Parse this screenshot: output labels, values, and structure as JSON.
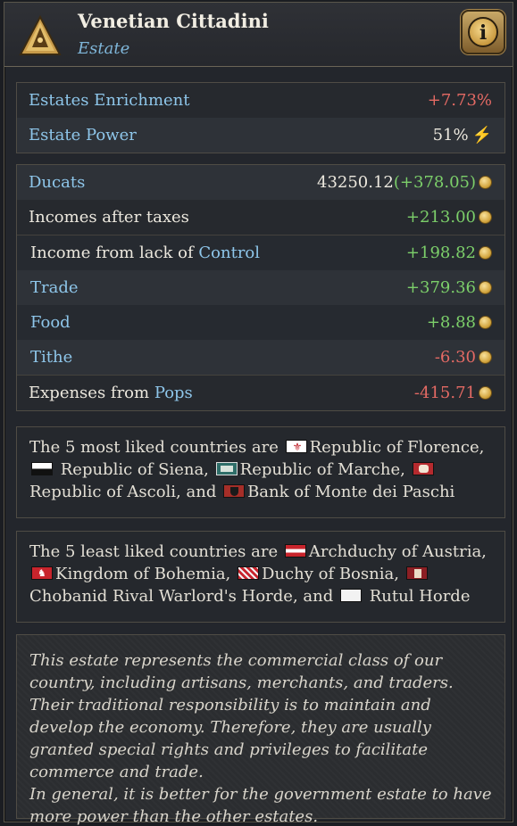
{
  "header": {
    "title": "Venetian Cittadini",
    "subtitle": "Estate",
    "info_glyph": "i"
  },
  "stats": {
    "enrichment_label": "Estates Enrichment",
    "enrichment_value": "+7.73%",
    "power_label": "Estate Power",
    "power_value": "51%"
  },
  "finance": {
    "ducats_label": "Ducats",
    "ducats_value": "43250.12",
    "ducats_change": "(+378.05)",
    "incomes_label": "Incomes after taxes",
    "incomes_value": "+213.00",
    "control_label_prefix": "Income from lack of ",
    "control_label_link": "Control",
    "control_value": "+198.82",
    "trade_label": "Trade",
    "trade_value": "+379.36",
    "food_label": "Food",
    "food_value": "+8.88",
    "tithe_label": "Tithe",
    "tithe_value": "-6.30",
    "expenses_label_prefix": "Expenses from ",
    "expenses_label_link": "Pops",
    "expenses_value": "-415.71"
  },
  "liked": {
    "prefix": "The 5 most liked countries are",
    "c1": "Republic of Florence,",
    "c2": "Republic of Siena,",
    "c3": "Republic of Marche,",
    "c4": "Republic of Ascoli, and",
    "c5": "Bank of Monte dei Paschi"
  },
  "disliked": {
    "prefix": "The 5 least liked countries are",
    "c1": "Archduchy of Austria,",
    "c2": "Kingdom of Bohemia,",
    "c3": "Duchy of Bosnia,",
    "c4": "Chobanid Rival Warlord's Horde, and",
    "c5": "Rutul Horde"
  },
  "description": {
    "p1": "This estate represents the commercial class of our country, including artisans, merchants, and traders. Their traditional responsibility is to maintain and develop the economy. Therefore, they are usually granted special rights and privileges to facilitate commerce and trade.",
    "p2": "In general, it is better for the government estate to have more power than the other estates."
  },
  "icons": {
    "estate": "merchant-pyramid-icon",
    "info": "info-icon",
    "power": "lightning-bolt-icon",
    "currency": "gold-coin-icon"
  },
  "colors": {
    "accent_blue": "#8ec6ea",
    "positive": "#7ccf6a",
    "negative": "#e46a64",
    "gold": "#d1a33c"
  }
}
